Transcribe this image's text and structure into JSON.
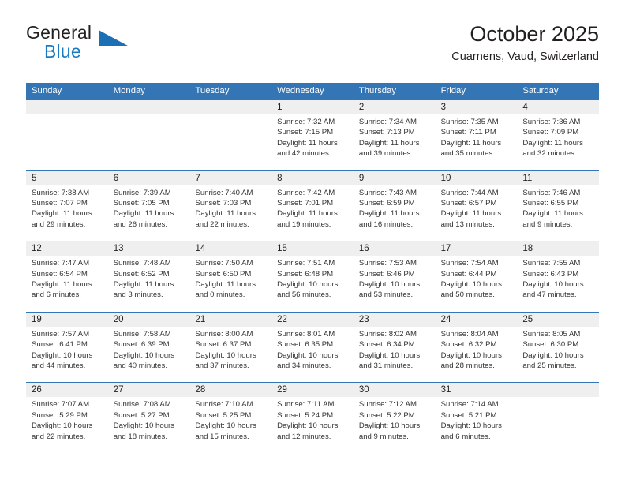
{
  "brand": {
    "word_one": "General",
    "word_two": "Blue",
    "accent_color": "#1b7ac2",
    "triangle_color": "#1d6fb5"
  },
  "header": {
    "title": "October 2025",
    "subtitle": "Cuarnens, Vaud, Switzerland"
  },
  "calendar": {
    "header_color": "#3476b5",
    "weekdays": [
      "Sunday",
      "Monday",
      "Tuesday",
      "Wednesday",
      "Thursday",
      "Friday",
      "Saturday"
    ],
    "weeks": [
      [
        {
          "day": "",
          "sunrise": "",
          "sunset": "",
          "daylight_line1": "",
          "daylight_line2": "",
          "empty": true
        },
        {
          "day": "",
          "sunrise": "",
          "sunset": "",
          "daylight_line1": "",
          "daylight_line2": "",
          "empty": true
        },
        {
          "day": "",
          "sunrise": "",
          "sunset": "",
          "daylight_line1": "",
          "daylight_line2": "",
          "empty": true
        },
        {
          "day": "1",
          "sunrise": "Sunrise: 7:32 AM",
          "sunset": "Sunset: 7:15 PM",
          "daylight_line1": "Daylight: 11 hours",
          "daylight_line2": "and 42 minutes.",
          "empty": false
        },
        {
          "day": "2",
          "sunrise": "Sunrise: 7:34 AM",
          "sunset": "Sunset: 7:13 PM",
          "daylight_line1": "Daylight: 11 hours",
          "daylight_line2": "and 39 minutes.",
          "empty": false
        },
        {
          "day": "3",
          "sunrise": "Sunrise: 7:35 AM",
          "sunset": "Sunset: 7:11 PM",
          "daylight_line1": "Daylight: 11 hours",
          "daylight_line2": "and 35 minutes.",
          "empty": false
        },
        {
          "day": "4",
          "sunrise": "Sunrise: 7:36 AM",
          "sunset": "Sunset: 7:09 PM",
          "daylight_line1": "Daylight: 11 hours",
          "daylight_line2": "and 32 minutes.",
          "empty": false
        }
      ],
      [
        {
          "day": "5",
          "sunrise": "Sunrise: 7:38 AM",
          "sunset": "Sunset: 7:07 PM",
          "daylight_line1": "Daylight: 11 hours",
          "daylight_line2": "and 29 minutes.",
          "empty": false
        },
        {
          "day": "6",
          "sunrise": "Sunrise: 7:39 AM",
          "sunset": "Sunset: 7:05 PM",
          "daylight_line1": "Daylight: 11 hours",
          "daylight_line2": "and 26 minutes.",
          "empty": false
        },
        {
          "day": "7",
          "sunrise": "Sunrise: 7:40 AM",
          "sunset": "Sunset: 7:03 PM",
          "daylight_line1": "Daylight: 11 hours",
          "daylight_line2": "and 22 minutes.",
          "empty": false
        },
        {
          "day": "8",
          "sunrise": "Sunrise: 7:42 AM",
          "sunset": "Sunset: 7:01 PM",
          "daylight_line1": "Daylight: 11 hours",
          "daylight_line2": "and 19 minutes.",
          "empty": false
        },
        {
          "day": "9",
          "sunrise": "Sunrise: 7:43 AM",
          "sunset": "Sunset: 6:59 PM",
          "daylight_line1": "Daylight: 11 hours",
          "daylight_line2": "and 16 minutes.",
          "empty": false
        },
        {
          "day": "10",
          "sunrise": "Sunrise: 7:44 AM",
          "sunset": "Sunset: 6:57 PM",
          "daylight_line1": "Daylight: 11 hours",
          "daylight_line2": "and 13 minutes.",
          "empty": false
        },
        {
          "day": "11",
          "sunrise": "Sunrise: 7:46 AM",
          "sunset": "Sunset: 6:55 PM",
          "daylight_line1": "Daylight: 11 hours",
          "daylight_line2": "and 9 minutes.",
          "empty": false
        }
      ],
      [
        {
          "day": "12",
          "sunrise": "Sunrise: 7:47 AM",
          "sunset": "Sunset: 6:54 PM",
          "daylight_line1": "Daylight: 11 hours",
          "daylight_line2": "and 6 minutes.",
          "empty": false
        },
        {
          "day": "13",
          "sunrise": "Sunrise: 7:48 AM",
          "sunset": "Sunset: 6:52 PM",
          "daylight_line1": "Daylight: 11 hours",
          "daylight_line2": "and 3 minutes.",
          "empty": false
        },
        {
          "day": "14",
          "sunrise": "Sunrise: 7:50 AM",
          "sunset": "Sunset: 6:50 PM",
          "daylight_line1": "Daylight: 11 hours",
          "daylight_line2": "and 0 minutes.",
          "empty": false
        },
        {
          "day": "15",
          "sunrise": "Sunrise: 7:51 AM",
          "sunset": "Sunset: 6:48 PM",
          "daylight_line1": "Daylight: 10 hours",
          "daylight_line2": "and 56 minutes.",
          "empty": false
        },
        {
          "day": "16",
          "sunrise": "Sunrise: 7:53 AM",
          "sunset": "Sunset: 6:46 PM",
          "daylight_line1": "Daylight: 10 hours",
          "daylight_line2": "and 53 minutes.",
          "empty": false
        },
        {
          "day": "17",
          "sunrise": "Sunrise: 7:54 AM",
          "sunset": "Sunset: 6:44 PM",
          "daylight_line1": "Daylight: 10 hours",
          "daylight_line2": "and 50 minutes.",
          "empty": false
        },
        {
          "day": "18",
          "sunrise": "Sunrise: 7:55 AM",
          "sunset": "Sunset: 6:43 PM",
          "daylight_line1": "Daylight: 10 hours",
          "daylight_line2": "and 47 minutes.",
          "empty": false
        }
      ],
      [
        {
          "day": "19",
          "sunrise": "Sunrise: 7:57 AM",
          "sunset": "Sunset: 6:41 PM",
          "daylight_line1": "Daylight: 10 hours",
          "daylight_line2": "and 44 minutes.",
          "empty": false
        },
        {
          "day": "20",
          "sunrise": "Sunrise: 7:58 AM",
          "sunset": "Sunset: 6:39 PM",
          "daylight_line1": "Daylight: 10 hours",
          "daylight_line2": "and 40 minutes.",
          "empty": false
        },
        {
          "day": "21",
          "sunrise": "Sunrise: 8:00 AM",
          "sunset": "Sunset: 6:37 PM",
          "daylight_line1": "Daylight: 10 hours",
          "daylight_line2": "and 37 minutes.",
          "empty": false
        },
        {
          "day": "22",
          "sunrise": "Sunrise: 8:01 AM",
          "sunset": "Sunset: 6:35 PM",
          "daylight_line1": "Daylight: 10 hours",
          "daylight_line2": "and 34 minutes.",
          "empty": false
        },
        {
          "day": "23",
          "sunrise": "Sunrise: 8:02 AM",
          "sunset": "Sunset: 6:34 PM",
          "daylight_line1": "Daylight: 10 hours",
          "daylight_line2": "and 31 minutes.",
          "empty": false
        },
        {
          "day": "24",
          "sunrise": "Sunrise: 8:04 AM",
          "sunset": "Sunset: 6:32 PM",
          "daylight_line1": "Daylight: 10 hours",
          "daylight_line2": "and 28 minutes.",
          "empty": false
        },
        {
          "day": "25",
          "sunrise": "Sunrise: 8:05 AM",
          "sunset": "Sunset: 6:30 PM",
          "daylight_line1": "Daylight: 10 hours",
          "daylight_line2": "and 25 minutes.",
          "empty": false
        }
      ],
      [
        {
          "day": "26",
          "sunrise": "Sunrise: 7:07 AM",
          "sunset": "Sunset: 5:29 PM",
          "daylight_line1": "Daylight: 10 hours",
          "daylight_line2": "and 22 minutes.",
          "empty": false
        },
        {
          "day": "27",
          "sunrise": "Sunrise: 7:08 AM",
          "sunset": "Sunset: 5:27 PM",
          "daylight_line1": "Daylight: 10 hours",
          "daylight_line2": "and 18 minutes.",
          "empty": false
        },
        {
          "day": "28",
          "sunrise": "Sunrise: 7:10 AM",
          "sunset": "Sunset: 5:25 PM",
          "daylight_line1": "Daylight: 10 hours",
          "daylight_line2": "and 15 minutes.",
          "empty": false
        },
        {
          "day": "29",
          "sunrise": "Sunrise: 7:11 AM",
          "sunset": "Sunset: 5:24 PM",
          "daylight_line1": "Daylight: 10 hours",
          "daylight_line2": "and 12 minutes.",
          "empty": false
        },
        {
          "day": "30",
          "sunrise": "Sunrise: 7:12 AM",
          "sunset": "Sunset: 5:22 PM",
          "daylight_line1": "Daylight: 10 hours",
          "daylight_line2": "and 9 minutes.",
          "empty": false
        },
        {
          "day": "31",
          "sunrise": "Sunrise: 7:14 AM",
          "sunset": "Sunset: 5:21 PM",
          "daylight_line1": "Daylight: 10 hours",
          "daylight_line2": "and 6 minutes.",
          "empty": false
        },
        {
          "day": "",
          "sunrise": "",
          "sunset": "",
          "daylight_line1": "",
          "daylight_line2": "",
          "empty": true
        }
      ]
    ]
  }
}
